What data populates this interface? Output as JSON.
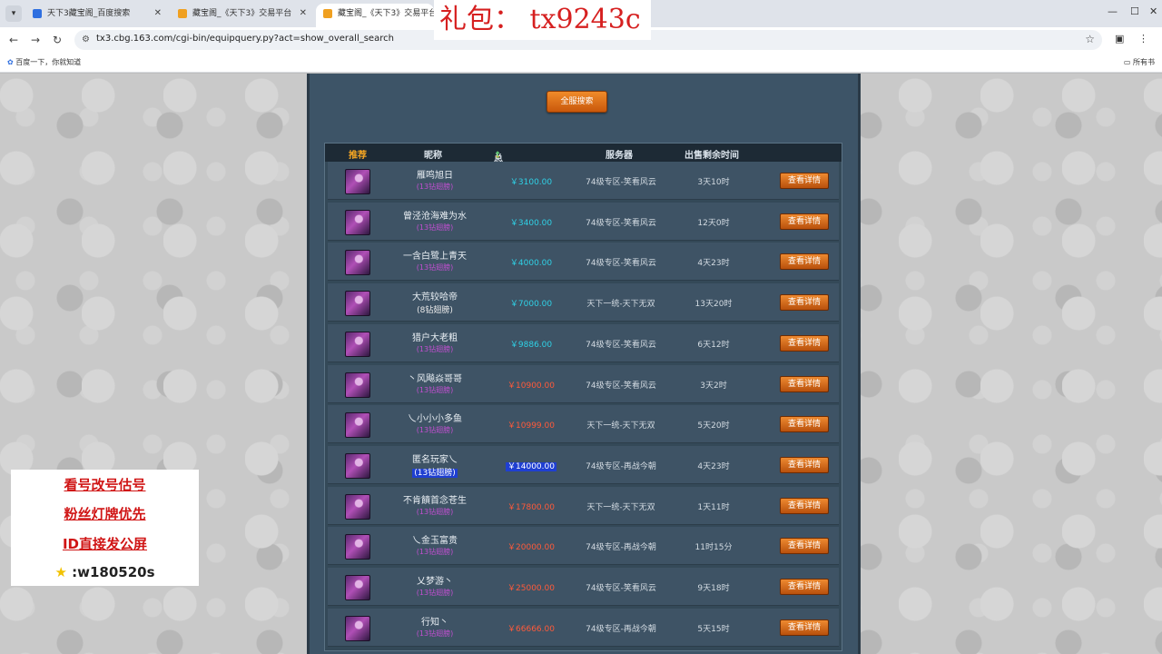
{
  "browser": {
    "tabs": [
      {
        "title": "天下3藏宝阁_百度搜索",
        "favicon_color": "#2f6fe0"
      },
      {
        "title": "藏宝阁_《天下3》交易平台",
        "favicon_color": "#f0a020"
      },
      {
        "title": "藏宝阁_《天下3》交易平台",
        "favicon_color": "#f0a020"
      }
    ],
    "url": "tx3.cbg.163.com/cgi-bin/equipquery.py?act=show_overall_search",
    "bookmark_left": "百度一下，你就知道",
    "bookmark_right": "所有书"
  },
  "overlay": {
    "gift_text": "礼包：  tx9243c",
    "promo_lines": [
      "看号改号估号",
      "粉丝灯牌优先",
      "ID直接发公屏",
      ":w180520s"
    ]
  },
  "search_button": "全服搜索",
  "table": {
    "headers": {
      "recommend": "推荐",
      "nickname": "昵称",
      "price": "总价(元)",
      "server": "服务器",
      "remaining": "出售剩余时间"
    },
    "detail_label": "查看详情",
    "rows": [
      {
        "name": "雁鸣旭日",
        "sub": "(13钻翅膀)",
        "price": "￥3100.00",
        "server": "74级专区-笑看风云",
        "remaining": "3天10时",
        "price_color": "cyan"
      },
      {
        "name": "曾泾沧海难为水",
        "sub": "(13钻翅膀)",
        "price": "￥3400.00",
        "server": "74级专区-笑看风云",
        "remaining": "12天0时",
        "price_color": "cyan"
      },
      {
        "name": "一含白鹭上青天",
        "sub": "(13钻翅膀)",
        "price": "￥4000.00",
        "server": "74级专区-笑看风云",
        "remaining": "4天23时",
        "price_color": "cyan"
      },
      {
        "name": "大荒较哈帝",
        "sub": "(8钻翅膀)",
        "price": "￥7000.00",
        "server": "天下一统-天下无双",
        "remaining": "13天20时",
        "price_color": "cyan"
      },
      {
        "name": "猎户大老粗",
        "sub": "(13钻翅膀)",
        "price": "￥9886.00",
        "server": "74级专区-笑看风云",
        "remaining": "6天12时",
        "price_color": "cyan"
      },
      {
        "name": "丶风飚焱哥哥",
        "sub": "(13钻翅膀)",
        "price": "￥10900.00",
        "server": "74级专区-笑看风云",
        "remaining": "3天2时",
        "price_color": "red"
      },
      {
        "name": "乀小小小多鱼",
        "sub": "(13钻翅膀)",
        "price": "￥10999.00",
        "server": "天下一统-天下无双",
        "remaining": "5天20时",
        "price_color": "red"
      },
      {
        "name": "匿名玩家乀",
        "sub": "(13钻翅膀)",
        "price": "￥14000.00",
        "server": "74级专区-再战今朝",
        "remaining": "4天23时",
        "price_color": "selected"
      },
      {
        "name": "不肯饋首念苍生",
        "sub": "(13钻翅膀)",
        "price": "￥17800.00",
        "server": "天下一统-天下无双",
        "remaining": "1天11时",
        "price_color": "red"
      },
      {
        "name": "乀金玉富贵",
        "sub": "(13钻翅膀)",
        "price": "￥20000.00",
        "server": "74级专区-再战今朝",
        "remaining": "11时15分",
        "price_color": "red"
      },
      {
        "name": "乂梦游丶",
        "sub": "(13钻翅膀)",
        "price": "￥25000.00",
        "server": "74级专区-笑看风云",
        "remaining": "9天18时",
        "price_color": "red"
      },
      {
        "name": "行知丶",
        "sub": "(13钻翅膀)",
        "price": "￥66666.00",
        "server": "74级专区-再战今朝",
        "remaining": "5天15时",
        "price_color": "red"
      }
    ]
  }
}
